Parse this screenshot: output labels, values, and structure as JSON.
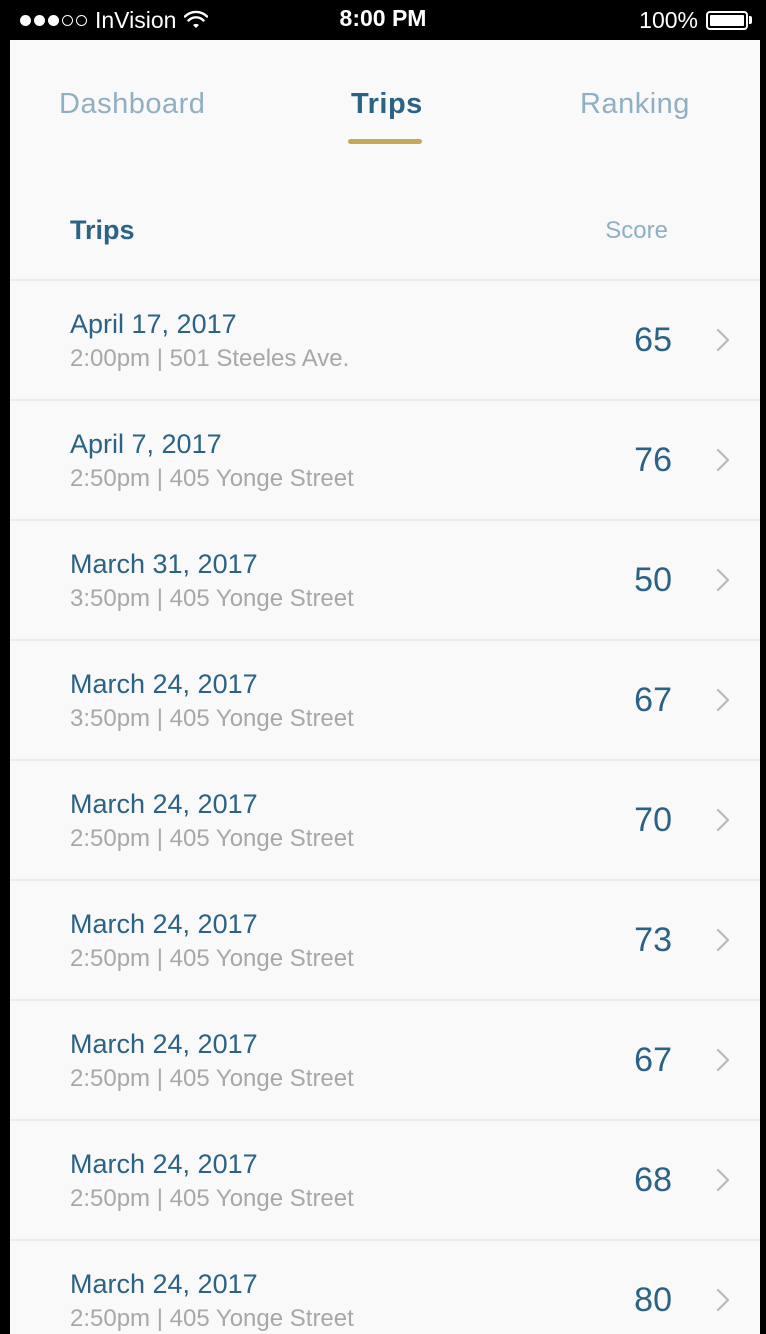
{
  "status_bar": {
    "carrier": "InVision",
    "time": "8:00 PM",
    "battery": "100%"
  },
  "tabs": [
    {
      "label": "Dashboard",
      "active": false
    },
    {
      "label": "Trips",
      "active": true
    },
    {
      "label": "Ranking",
      "active": false
    }
  ],
  "list_header": {
    "title": "Trips",
    "score_label": "Score"
  },
  "trips": [
    {
      "date": "April 17, 2017",
      "detail": "2:00pm | 501 Steeles Ave.",
      "score": "65"
    },
    {
      "date": "April 7, 2017",
      "detail": "2:50pm | 405 Yonge Street",
      "score": "76"
    },
    {
      "date": "March 31, 2017",
      "detail": "3:50pm | 405 Yonge Street",
      "score": "50"
    },
    {
      "date": "March 24, 2017",
      "detail": "3:50pm | 405 Yonge Street",
      "score": "67"
    },
    {
      "date": "March 24, 2017",
      "detail": "2:50pm | 405 Yonge Street",
      "score": "70"
    },
    {
      "date": "March 24, 2017",
      "detail": "2:50pm | 405 Yonge Street",
      "score": "73"
    },
    {
      "date": "March 24, 2017",
      "detail": "2:50pm | 405 Yonge Street",
      "score": "67"
    },
    {
      "date": "March 24, 2017",
      "detail": "2:50pm | 405 Yonge Street",
      "score": "68"
    },
    {
      "date": "March 24, 2017",
      "detail": "2:50pm | 405 Yonge Street",
      "score": "80"
    }
  ],
  "colors": {
    "primary": "#2b6385",
    "muted": "#8fafc3",
    "accent": "#c6a85a",
    "secondary_text": "#a8a8a8",
    "background": "#f9f9f9"
  }
}
